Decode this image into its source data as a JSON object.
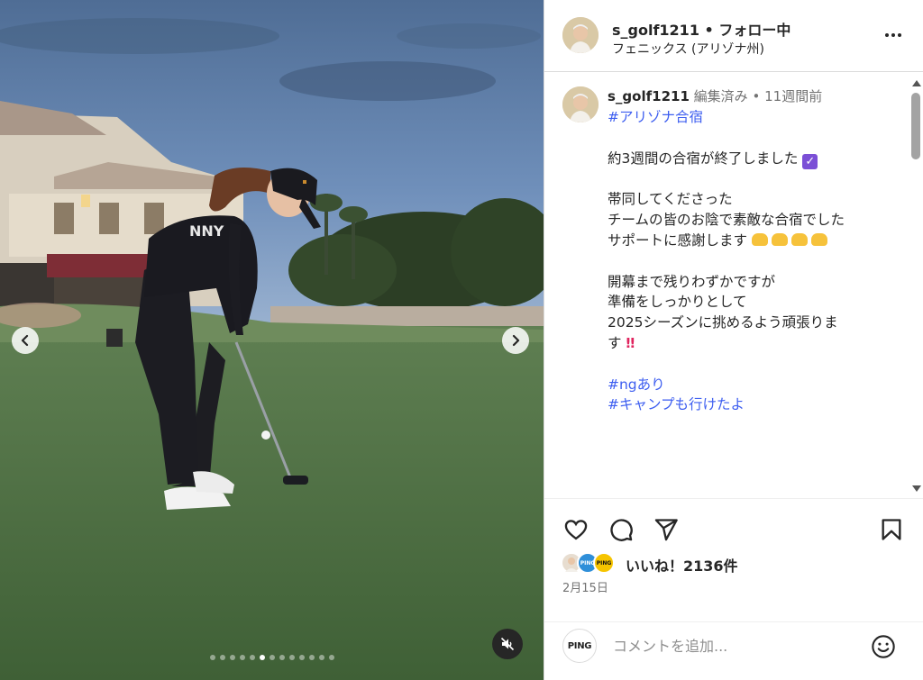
{
  "header": {
    "username": "s_golf1211",
    "separator": "•",
    "follow_status": "フォロー中",
    "location": "フェニックス (アリゾナ州)"
  },
  "caption": {
    "username": "s_golf1211",
    "edited": "編集済み",
    "separator": "•",
    "time_ago": "11週間前",
    "lines": {
      "l1": "#アリゾナ合宿",
      "l2": "約3週間の合宿が終了しました",
      "l3": "帯同してくださった",
      "l4": "チームの皆のお陰で素敵な合宿でした",
      "l5": "サポートに感謝します",
      "l6": "開幕まで残りわずかですが",
      "l7": "準備をしっかりとして",
      "l8": "2025シーズンに挑めるよう頑張りま",
      "l9": "す",
      "l10": "#ngあり",
      "l11": "#キャンプも行けたよ"
    },
    "emoji": {
      "check": "✓",
      "bang": "‼"
    }
  },
  "actions": {
    "likes": "いいね！2136件",
    "date": "2月15日",
    "liker_badges": [
      "PING",
      "PING"
    ]
  },
  "comment": {
    "avatar_text": "PING",
    "placeholder": "コメントを追加..."
  },
  "media": {
    "carousel_count": 13,
    "carousel_active_index": 5
  },
  "icons": {
    "prev": "chevron-left-icon",
    "next": "chevron-right-icon",
    "mute": "speaker-muted-icon",
    "more": "more-horizontal-icon",
    "like": "heart-icon",
    "comment": "comment-bubble-icon",
    "share": "paper-plane-icon",
    "save": "bookmark-icon",
    "emoji": "smiley-icon"
  },
  "colors": {
    "hashtag": "#3d5ef0",
    "muted_text": "#737373",
    "text": "#262626"
  }
}
